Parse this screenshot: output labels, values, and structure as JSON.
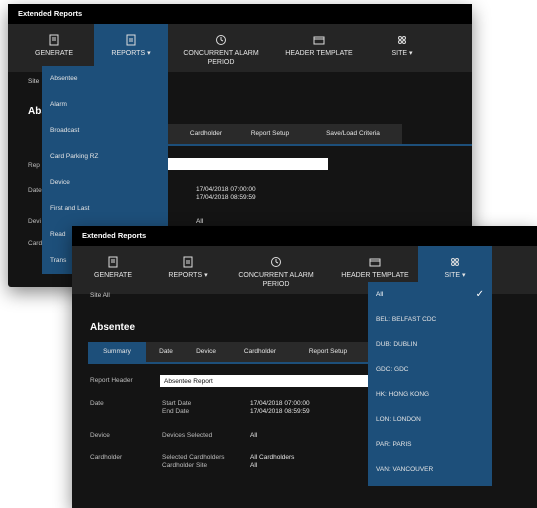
{
  "back_window": {
    "title": "Extended Reports",
    "toolbar": [
      {
        "label": "GENERATE",
        "icon": "generate-icon"
      },
      {
        "label": "REPORTS ▾",
        "icon": "reports-icon"
      },
      {
        "label": "CONCURRENT ALARM PERIOD",
        "icon": "alarm-clock-icon"
      },
      {
        "label": "HEADER TEMPLATE",
        "icon": "header-template-icon"
      },
      {
        "label": "SITE ▾",
        "icon": "site-icon"
      }
    ],
    "crumb": "Site",
    "heading": "Abs",
    "tabs": [
      "Cardholder",
      "Report Setup",
      "Save/Load Criteria"
    ],
    "row_labels": [
      "Rep",
      "Date",
      "Devi",
      "Card"
    ],
    "date_start": "17/04/2018 07:00:00",
    "date_end": "17/04/2018 08:59:59",
    "device_value": "All",
    "reports_menu": [
      "Absentee",
      "Alarm",
      "Broadcast",
      "Card Parking RZ",
      "Device",
      "First and Last",
      "Read",
      "Trans"
    ]
  },
  "front_window": {
    "title": "Extended Reports",
    "toolbar": [
      {
        "label": "GENERATE",
        "icon": "generate-icon"
      },
      {
        "label": "REPORTS ▾",
        "icon": "reports-icon"
      },
      {
        "label": "CONCURRENT ALARM PERIOD",
        "icon": "alarm-clock-icon"
      },
      {
        "label": "HEADER TEMPLATE",
        "icon": "header-template-icon"
      },
      {
        "label": "SITE ▾",
        "icon": "site-icon"
      }
    ],
    "crumb": "Site  All",
    "heading": "Absentee",
    "tabs": [
      "Summary",
      "Date",
      "Device",
      "Cardholder",
      "Report Setup"
    ],
    "report_header_label": "Report Header",
    "report_header_value": "Absentee Report",
    "date_label": "Date",
    "start_date_label": "Start Date",
    "end_date_label": "End Date",
    "start_date": "17/04/2018 07:00:00",
    "end_date": "17/04/2018 08:59:59",
    "device_label": "Device",
    "devices_selected_label": "Devices Selected",
    "devices_selected_value": "All",
    "cardholder_label": "Cardholder",
    "selected_cardholders_label": "Selected Cardholders",
    "cardholder_site_label": "Cardholder Site",
    "selected_cardholders_value": "All Cardholders",
    "cardholder_site_value": "All",
    "site_menu": [
      "All",
      "BEL: BELFAST CDC",
      "DUB: DUBLIN",
      "GDC: GDC",
      "HK: HONG KONG",
      "LON: LONDON",
      "PAR: PARIS",
      "VAN: VANCOUVER"
    ],
    "site_selected": "All",
    "check_mark": "✓"
  },
  "colors": {
    "accent": "#1d4f7a",
    "toolbar": "#252525",
    "background": "#141414"
  }
}
